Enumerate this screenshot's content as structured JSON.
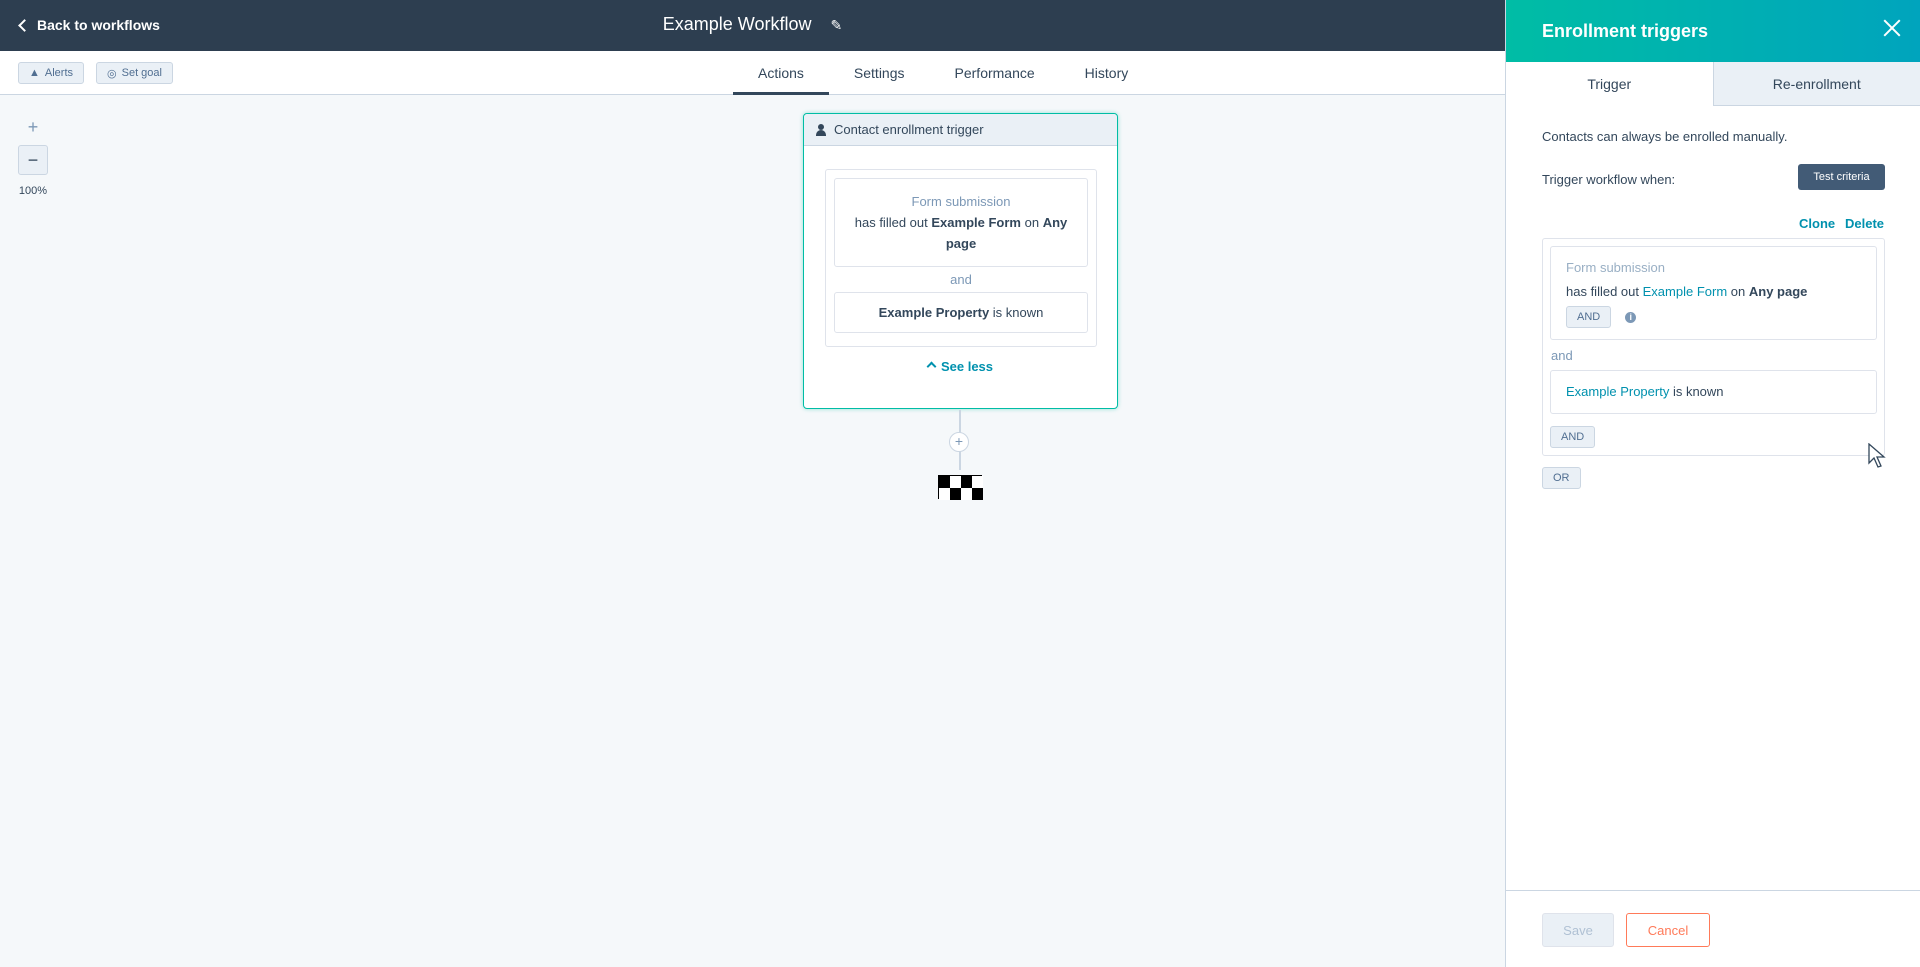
{
  "topbar": {
    "back_label": "Back to workflows",
    "workflow_title": "Example Workflow"
  },
  "subbar": {
    "alerts_label": "Alerts",
    "set_goal_label": "Set goal",
    "tabs": [
      {
        "label": "Actions",
        "active": true
      },
      {
        "label": "Settings",
        "active": false
      },
      {
        "label": "Performance",
        "active": false
      },
      {
        "label": "History",
        "active": false
      }
    ]
  },
  "zoom": {
    "plus": "+",
    "minus": "−",
    "level": "100%"
  },
  "trigger_card": {
    "header": "Contact enrollment trigger",
    "condition1": {
      "type": "Form submission",
      "prefix": "has filled out",
      "form": "Example Form",
      "on": "on",
      "page": "Any page"
    },
    "and_label": "and",
    "condition2": {
      "property": "Example Property",
      "suffix": "is known"
    },
    "see_less": "See less"
  },
  "panel": {
    "title": "Enrollment triggers",
    "tabs": [
      {
        "label": "Trigger",
        "active": true
      },
      {
        "label": "Re-enrollment",
        "active": false
      }
    ],
    "manual_note": "Contacts can always be enrolled manually.",
    "trigger_when": "Trigger workflow when:",
    "test_criteria": "Test criteria",
    "clone": "Clone",
    "delete": "Delete",
    "filter1": {
      "type": "Form submission",
      "prefix": "has filled out",
      "form": "Example Form",
      "on": "on",
      "page": "Any page",
      "and_button": "AND",
      "info": "i"
    },
    "and_label": "and",
    "filter2": {
      "property": "Example Property",
      "suffix": "is known"
    },
    "group_and_button": "AND",
    "or_button": "OR",
    "save": "Save",
    "cancel": "Cancel"
  },
  "colors": {
    "topbar": "#2d3e50",
    "accent_teal": "#00bda5",
    "link": "#0091ae",
    "cancel": "#ff7a59"
  }
}
